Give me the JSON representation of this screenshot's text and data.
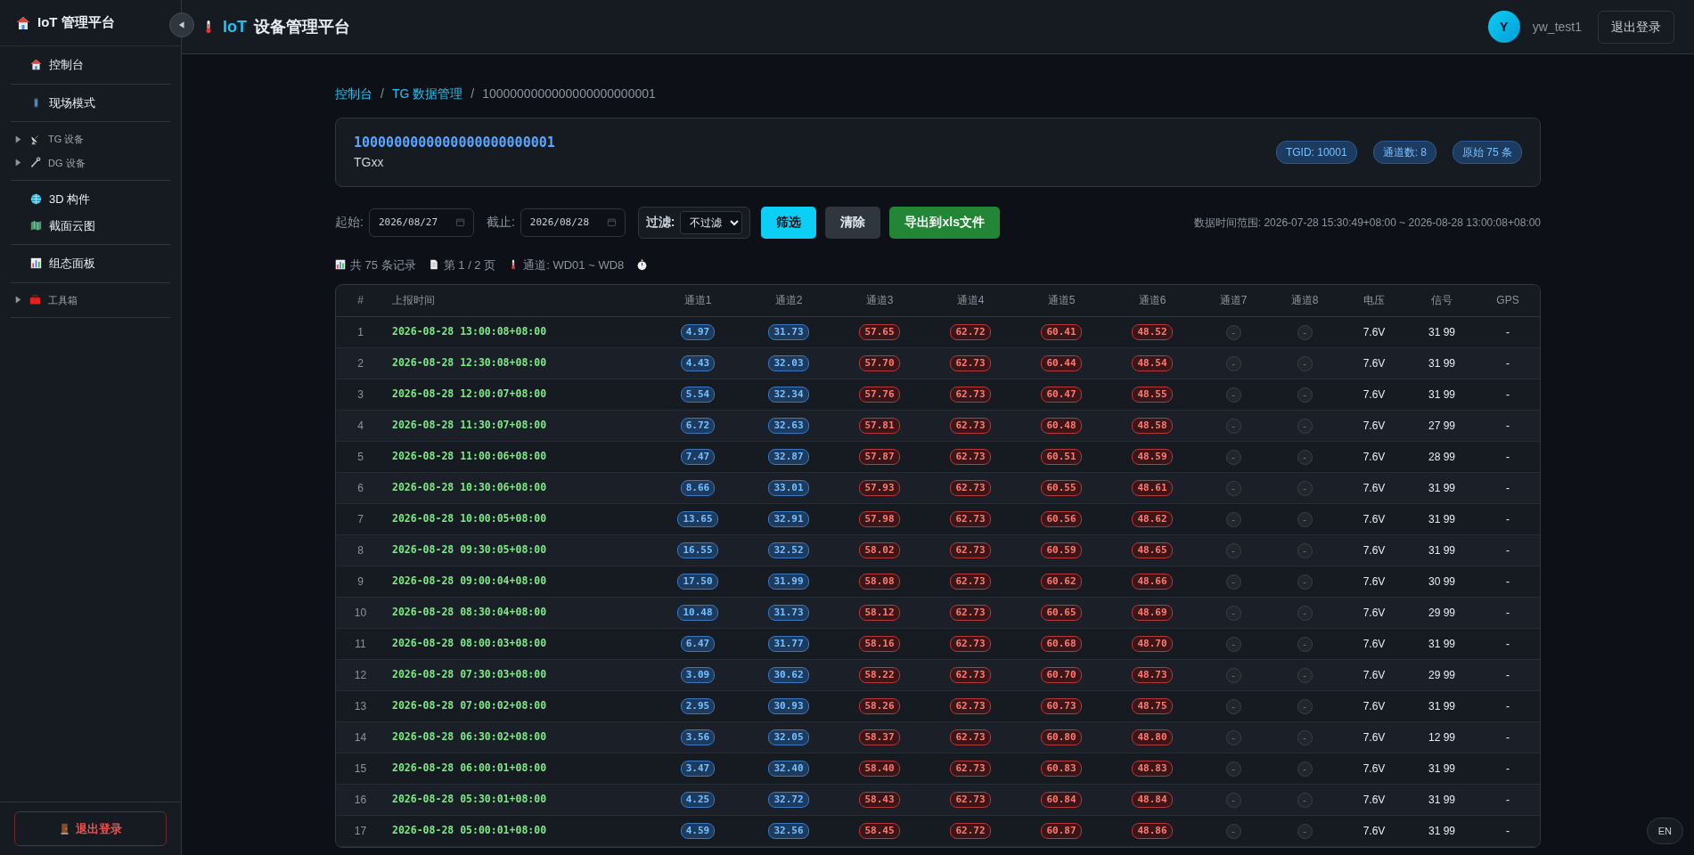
{
  "sidebar": {
    "title": "IoT 管理平台",
    "groups": [
      {
        "items": [
          {
            "label": "控制台",
            "kind": "link"
          }
        ]
      },
      {
        "items": [
          {
            "label": "现场模式",
            "kind": "link"
          }
        ]
      },
      {
        "items": [
          {
            "label": "TG 设备",
            "kind": "tree",
            "expanded": false
          },
          {
            "label": "DG 设备",
            "kind": "tree",
            "expanded": false
          }
        ]
      },
      {
        "items": [
          {
            "label": "3D 构件",
            "kind": "link"
          },
          {
            "label": "截面云图",
            "kind": "link"
          }
        ]
      },
      {
        "items": [
          {
            "label": "组态面板",
            "kind": "link"
          }
        ]
      },
      {
        "items": [
          {
            "label": "工具箱",
            "kind": "tree",
            "expanded": false
          }
        ]
      }
    ],
    "logout": "退出登录"
  },
  "header": {
    "brand": "IoT",
    "title": "设备管理平台",
    "avatar": "Y",
    "user": "yw_test1",
    "logout": "退出登录"
  },
  "breadcrumb": [
    {
      "label": "控制台",
      "kind": "link"
    },
    {
      "label": "/",
      "kind": "separator"
    },
    {
      "label": "TG 数据管理",
      "kind": "link"
    },
    {
      "label": "/",
      "kind": "separator"
    },
    {
      "label": "1000000000000000000000001",
      "kind": "current"
    }
  ],
  "device": {
    "id": "1000000000000000000000001",
    "name": "TGxx",
    "badges": [
      "TGID: 10001",
      "通道数: 8",
      "原始 75 条"
    ]
  },
  "filters": {
    "start_label": "起始:",
    "start": "2026/08/27",
    "end_label": "截止:",
    "end": "2026/08/28",
    "filter_label": "过滤:",
    "filter_value": "不过滤",
    "buttons": [
      {
        "label": "筛选",
        "kind": "primary"
      },
      {
        "label": "清除",
        "kind": "secondary"
      },
      {
        "label": "导出到xls文件",
        "kind": "success"
      }
    ],
    "range": "数据时间范围: 2026-07-28 15:30:49+08:00 ~ 2026-08-28 13:00:08+08:00"
  },
  "stats": [
    "共 75 条记录",
    "第 1 / 2 页",
    "通道: WD01 ~ WD8"
  ],
  "table": {
    "columns": [
      {
        "label": "#",
        "kind": "index"
      },
      {
        "label": "上报时间",
        "kind": "time"
      },
      {
        "label": "通道1",
        "kind": "cool"
      },
      {
        "label": "通道2",
        "kind": "cool"
      },
      {
        "label": "通道3",
        "kind": "warm"
      },
      {
        "label": "通道4",
        "kind": "warm"
      },
      {
        "label": "通道5",
        "kind": "warm"
      },
      {
        "label": "通道6",
        "kind": "warm"
      },
      {
        "label": "通道7",
        "kind": "muted"
      },
      {
        "label": "通道8",
        "kind": "muted"
      },
      {
        "label": "电压",
        "kind": "text"
      },
      {
        "label": "信号",
        "kind": "text"
      },
      {
        "label": "GPS",
        "kind": "text"
      }
    ],
    "rows": [
      [
        "1",
        "2026-08-28 13:00:08+08:00",
        "4.97",
        "31.73",
        "57.65",
        "62.72",
        "60.41",
        "48.52",
        "-",
        "-",
        "7.6V",
        "31 99",
        "-"
      ],
      [
        "2",
        "2026-08-28 12:30:08+08:00",
        "4.43",
        "32.03",
        "57.70",
        "62.73",
        "60.44",
        "48.54",
        "-",
        "-",
        "7.6V",
        "31 99",
        "-"
      ],
      [
        "3",
        "2026-08-28 12:00:07+08:00",
        "5.54",
        "32.34",
        "57.76",
        "62.73",
        "60.47",
        "48.55",
        "-",
        "-",
        "7.6V",
        "31 99",
        "-"
      ],
      [
        "4",
        "2026-08-28 11:30:07+08:00",
        "6.72",
        "32.63",
        "57.81",
        "62.73",
        "60.48",
        "48.58",
        "-",
        "-",
        "7.6V",
        "27 99",
        "-"
      ],
      [
        "5",
        "2026-08-28 11:00:06+08:00",
        "7.47",
        "32.87",
        "57.87",
        "62.73",
        "60.51",
        "48.59",
        "-",
        "-",
        "7.6V",
        "28 99",
        "-"
      ],
      [
        "6",
        "2026-08-28 10:30:06+08:00",
        "8.66",
        "33.01",
        "57.93",
        "62.73",
        "60.55",
        "48.61",
        "-",
        "-",
        "7.6V",
        "31 99",
        "-"
      ],
      [
        "7",
        "2026-08-28 10:00:05+08:00",
        "13.65",
        "32.91",
        "57.98",
        "62.73",
        "60.56",
        "48.62",
        "-",
        "-",
        "7.6V",
        "31 99",
        "-"
      ],
      [
        "8",
        "2026-08-28 09:30:05+08:00",
        "16.55",
        "32.52",
        "58.02",
        "62.73",
        "60.59",
        "48.65",
        "-",
        "-",
        "7.6V",
        "31 99",
        "-"
      ],
      [
        "9",
        "2026-08-28 09:00:04+08:00",
        "17.50",
        "31.99",
        "58.08",
        "62.73",
        "60.62",
        "48.66",
        "-",
        "-",
        "7.6V",
        "30 99",
        "-"
      ],
      [
        "10",
        "2026-08-28 08:30:04+08:00",
        "10.48",
        "31.73",
        "58.12",
        "62.73",
        "60.65",
        "48.69",
        "-",
        "-",
        "7.6V",
        "29 99",
        "-"
      ],
      [
        "11",
        "2026-08-28 08:00:03+08:00",
        "6.47",
        "31.77",
        "58.16",
        "62.73",
        "60.68",
        "48.70",
        "-",
        "-",
        "7.6V",
        "31 99",
        "-"
      ],
      [
        "12",
        "2026-08-28 07:30:03+08:00",
        "3.09",
        "30.62",
        "58.22",
        "62.73",
        "60.70",
        "48.73",
        "-",
        "-",
        "7.6V",
        "29 99",
        "-"
      ],
      [
        "13",
        "2026-08-28 07:00:02+08:00",
        "2.95",
        "30.93",
        "58.26",
        "62.73",
        "60.73",
        "48.75",
        "-",
        "-",
        "7.6V",
        "31 99",
        "-"
      ],
      [
        "14",
        "2026-08-28 06:30:02+08:00",
        "3.56",
        "32.05",
        "58.37",
        "62.73",
        "60.80",
        "48.80",
        "-",
        "-",
        "7.6V",
        "12 99",
        "-"
      ],
      [
        "15",
        "2026-08-28 06:00:01+08:00",
        "3.47",
        "32.40",
        "58.40",
        "62.73",
        "60.83",
        "48.83",
        "-",
        "-",
        "7.6V",
        "31 99",
        "-"
      ],
      [
        "16",
        "2026-08-28 05:30:01+08:00",
        "4.25",
        "32.72",
        "58.43",
        "62.73",
        "60.84",
        "48.84",
        "-",
        "-",
        "7.6V",
        "31 99",
        "-"
      ],
      [
        "17",
        "2026-08-28 05:00:01+08:00",
        "4.59",
        "32.56",
        "58.45",
        "62.72",
        "60.87",
        "48.86",
        "-",
        "-",
        "7.6V",
        "31 99",
        "-"
      ]
    ]
  },
  "lang": "EN"
}
